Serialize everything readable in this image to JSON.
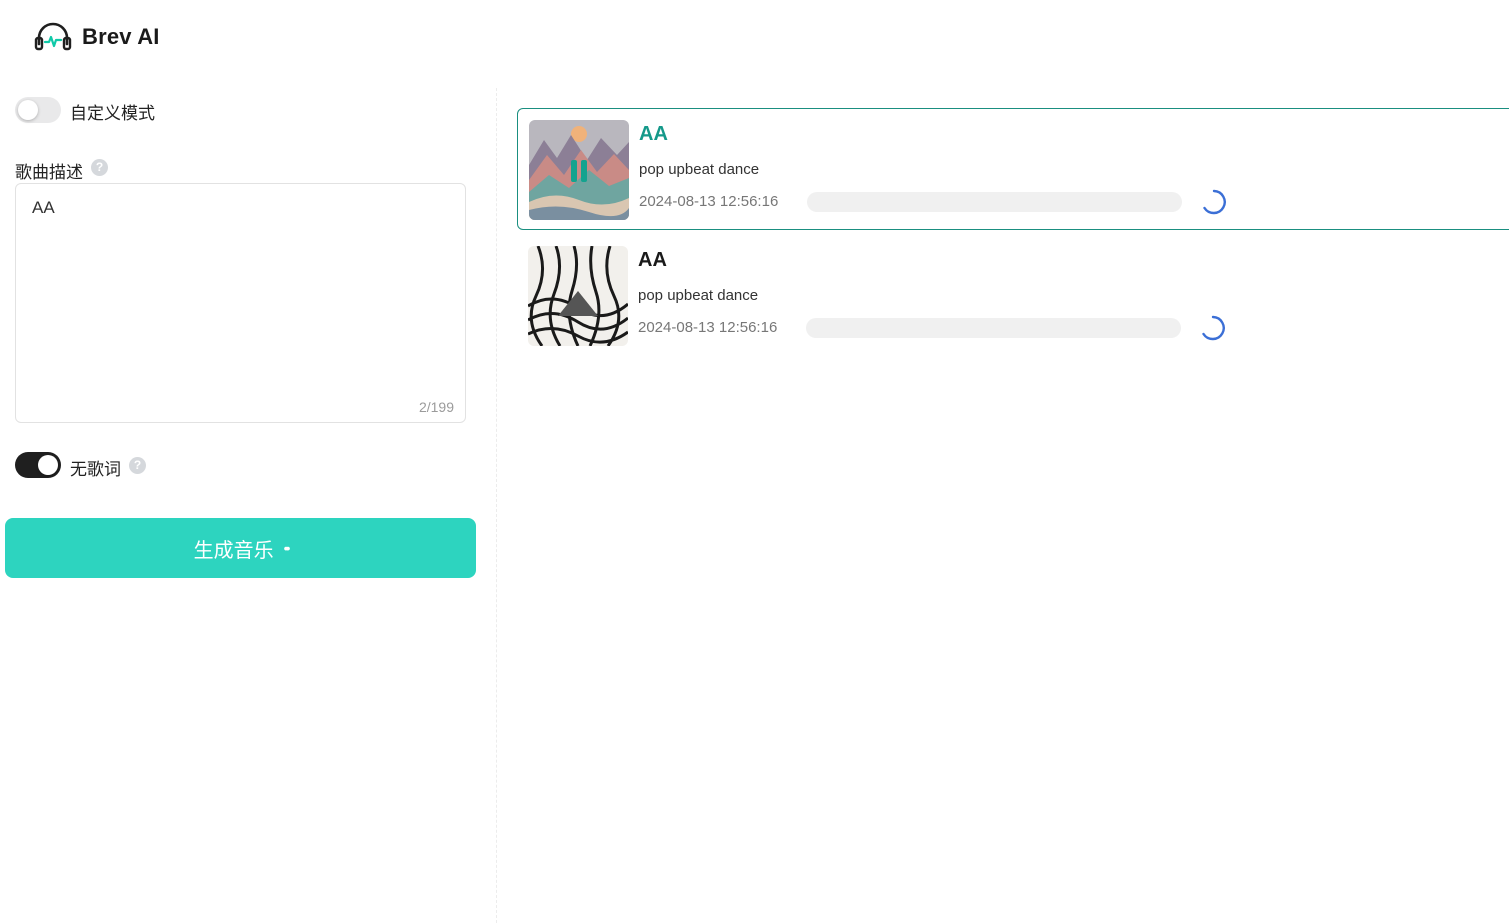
{
  "app": {
    "name": "Brev AI"
  },
  "form": {
    "custom_mode": {
      "label": "自定义模式",
      "enabled": false
    },
    "description": {
      "label": "歌曲描述",
      "value": "AA",
      "counter": "2/199"
    },
    "instrumental": {
      "label": "无歌词",
      "enabled": true
    },
    "generate_button": {
      "label": "生成音乐",
      "loading_indicator": "••"
    }
  },
  "songs": [
    {
      "title": "AA",
      "tags": "pop upbeat dance",
      "created": "2024-08-13 12:56:16",
      "state": "playing",
      "active": true
    },
    {
      "title": "AA",
      "tags": "pop upbeat dance",
      "created": "2024-08-13 12:56:16",
      "state": "loading",
      "active": false
    }
  ],
  "colors": {
    "accent": "#2dd4bf",
    "active_title": "#15998a",
    "active_border": "#1a8f80",
    "spinner": "#3b6fd6"
  }
}
